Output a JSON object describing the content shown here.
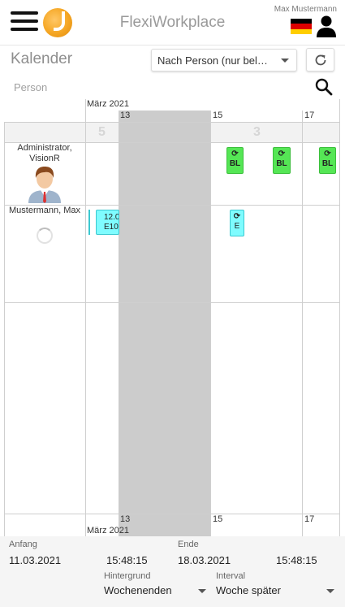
{
  "header": {
    "app_title": "FlexiWorkplace",
    "user_name": "Max Mustermann",
    "language_icon": "german-flag-icon",
    "colors": {
      "flag_black": "#000000",
      "flag_red": "#dd0000",
      "flag_gold": "#ffce00",
      "logo": "#f5a623"
    }
  },
  "toolbar": {
    "title": "Kalender",
    "view_select": "Nach Person (nur bel…",
    "person_filter_placeholder": "Person"
  },
  "calendar": {
    "month_top": "März 2021",
    "month_bottom": "März 2021",
    "dates": [
      "13",
      "15",
      "17"
    ],
    "week_numbers": [
      "5",
      "3"
    ],
    "highlight_color": "#cccccc",
    "persons": [
      {
        "name_line1": "Administrator,",
        "name_line2": "VisionR"
      },
      {
        "name_line1": "Mustermann, Max",
        "name_line2": ""
      }
    ],
    "events": [
      {
        "label": "BL",
        "color": "#55e655"
      },
      {
        "label": "BL",
        "color": "#55e655"
      },
      {
        "label": "BL",
        "color": "#55e655"
      },
      {
        "label_line1": "12.0",
        "label_line2": "E10",
        "color": "#7ffcff"
      },
      {
        "label": "E",
        "color": "#7ffcff"
      }
    ]
  },
  "footer": {
    "start_label": "Anfang",
    "start_date": "11.03.2021",
    "start_time": "15:48:15",
    "end_label": "Ende",
    "end_date": "18.03.2021",
    "end_time": "15:48:15",
    "background_label": "Hintergrund",
    "background_value": "Wochenenden",
    "interval_label": "Interval",
    "interval_value": "Woche später"
  }
}
